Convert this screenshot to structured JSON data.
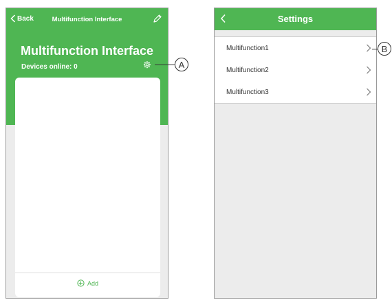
{
  "left_screen": {
    "back_label": "Back",
    "header_title": "Multifunction Interface",
    "big_title": "Multifunction Interface",
    "devices_online": "Devices online: 0",
    "add_label": "Add"
  },
  "right_screen": {
    "header_title": "Settings",
    "items": [
      {
        "label": "Multifunction1"
      },
      {
        "label": "Multifunction2"
      },
      {
        "label": "Multifunction3"
      }
    ]
  },
  "callouts": {
    "a": "A",
    "b": "B"
  },
  "colors": {
    "accent_green": "#4fb653",
    "background_gray": "#ececec"
  },
  "icons": [
    "chevron-left-icon",
    "pencil-icon",
    "gear-icon",
    "plus-circle-icon",
    "chevron-right-icon"
  ]
}
